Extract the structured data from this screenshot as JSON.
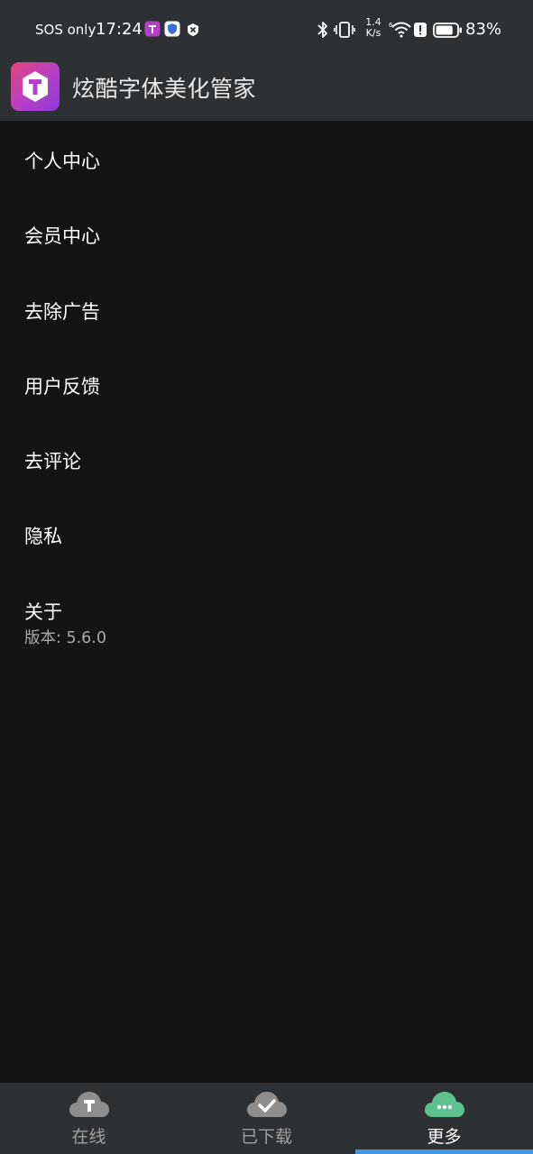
{
  "status_bar": {
    "carrier": "SOS only",
    "time": "17:24",
    "speed_value": "1.4",
    "speed_unit": "K/s",
    "battery_percent": "83%",
    "icons": [
      "app-notification-icon",
      "shield-icon",
      "close-badge-icon",
      "bluetooth-icon",
      "vibrate-icon",
      "wifi-icon",
      "alert-icon",
      "battery-icon"
    ],
    "battery_level": 0.83
  },
  "app_bar": {
    "logo_icon": "app-logo-t-icon",
    "title": "炫酷字体美化管家"
  },
  "menu": {
    "items": [
      {
        "label": "个人中心"
      },
      {
        "label": "会员中心"
      },
      {
        "label": "去除广告"
      },
      {
        "label": "用户反馈"
      },
      {
        "label": "去评论"
      },
      {
        "label": "隐私"
      },
      {
        "label": "关于",
        "sub": "版本: 5.6.0"
      }
    ]
  },
  "bottom_nav": {
    "tabs": [
      {
        "label": "在线",
        "icon": "cloud-t-icon",
        "active": false
      },
      {
        "label": "已下载",
        "icon": "cloud-check-icon",
        "active": false
      },
      {
        "label": "更多",
        "icon": "cloud-more-icon",
        "active": true
      }
    ]
  },
  "colors": {
    "background": "#141414",
    "bar": "#2e3134",
    "inactive_icon": "#8e8e8e",
    "active_icon": "#5cc18f",
    "indicator": "#3f97e6",
    "logo_start": "#e4457a",
    "logo_end": "#8b3ad6"
  }
}
